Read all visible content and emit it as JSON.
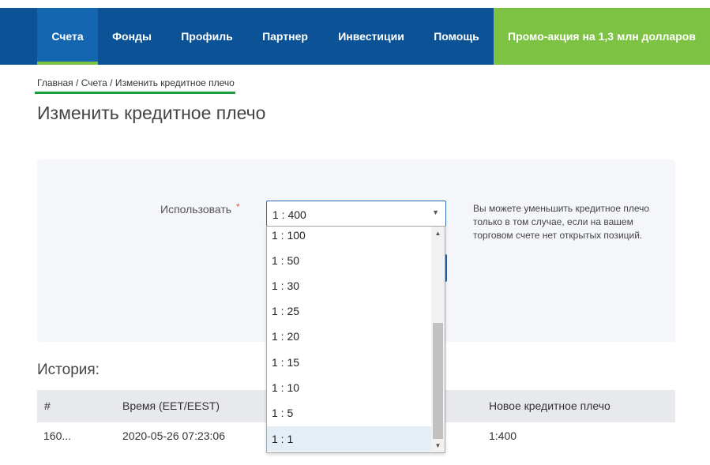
{
  "nav": {
    "items": [
      "Счета",
      "Фонды",
      "Профиль",
      "Партнер",
      "Инвестиции",
      "Помощь"
    ],
    "active": "Счета",
    "promo": "Промо-акция на 1,3 млн долларов"
  },
  "breadcrumb": {
    "home": "Главная",
    "accounts": "Счета",
    "current": "Изменить кредитное плечо",
    "separator": "/"
  },
  "page": {
    "title": "Изменить кредитное плечо"
  },
  "form": {
    "label": "Использовать",
    "required_mark": "*",
    "selected": "1 : 400",
    "hint": "Вы можете уменьшить кредитное плечо только в том случае, если на вашем торговом счете нет открытых позиций."
  },
  "dropdown": {
    "options": [
      "1 : 100",
      "1 : 50",
      "1 : 30",
      "1 : 25",
      "1 : 20",
      "1 : 15",
      "1 : 10",
      "1 : 5",
      "1 : 1"
    ],
    "highlighted": "1 : 1"
  },
  "history": {
    "title": "История:",
    "columns": [
      "#",
      "Время (EET/EEST)",
      "Новое кредитное плечо"
    ],
    "rows": [
      {
        "id": "160...",
        "time": "2020-05-26 07:23:06",
        "new_leverage": "1:400"
      }
    ]
  },
  "colors": {
    "nav_bg": "#0b5396",
    "nav_active": "#1566b0",
    "promo_bg": "#7dc242",
    "accent_green": "#1a9f3e",
    "select_border": "#2d6db5"
  }
}
